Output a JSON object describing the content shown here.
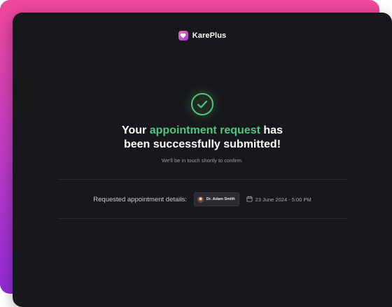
{
  "brand": {
    "name": "KarePlus",
    "logo_icon": "heart-logo-icon"
  },
  "confirmation": {
    "headline_prefix": "Your",
    "headline_accent": "appointment request",
    "headline_suffix": "has",
    "headline_line2": "been successfully submitted!",
    "subline": "We'll be in touch shortly to confirm.",
    "status_icon": "check-circle-icon"
  },
  "details": {
    "label": "Requested appointment details:",
    "doctor": "Dr. Adam Smith",
    "datetime": "23 June 2024 - 5:00 PM",
    "date_icon": "calendar-icon"
  },
  "colors": {
    "accent": "#4fc77e",
    "panel": "#17181b",
    "gradient_top": "#f0489a",
    "gradient_bottom": "#8f2bd6"
  }
}
